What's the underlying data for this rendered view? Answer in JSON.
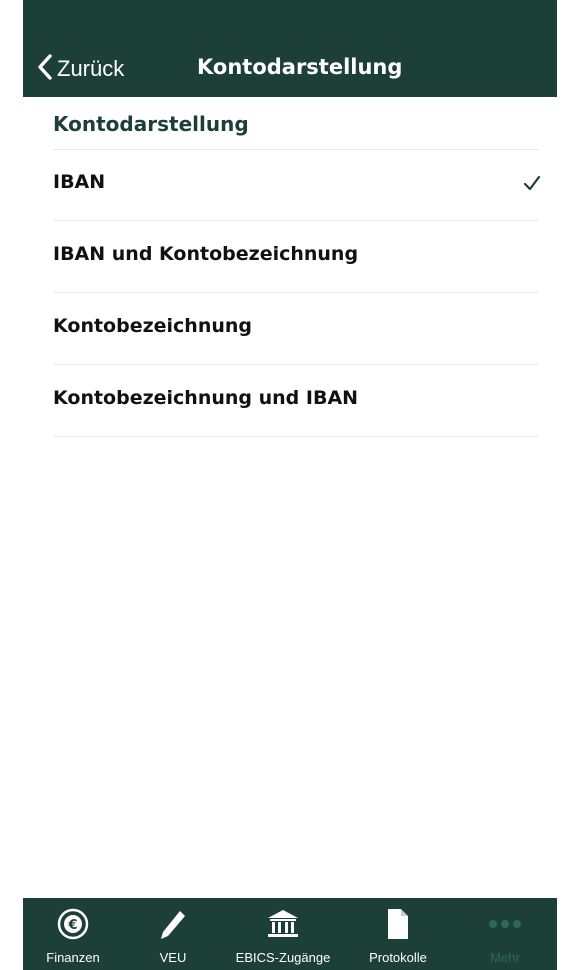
{
  "nav": {
    "back_label": "Zurück",
    "title": "Kontodarstellung"
  },
  "section": {
    "title": "Kontodarstellung"
  },
  "options": [
    {
      "label": "IBAN",
      "selected": true
    },
    {
      "label": "IBAN und Kontobezeichnung",
      "selected": false
    },
    {
      "label": "Kontobezeichnung",
      "selected": false
    },
    {
      "label": "Kontobezeichnung und IBAN",
      "selected": false
    }
  ],
  "tabs": [
    {
      "label": "Finanzen",
      "icon": "euro-icon"
    },
    {
      "label": "VEU",
      "icon": "pen-icon"
    },
    {
      "label": "EBICS-Zugänge",
      "icon": "bank-icon"
    },
    {
      "label": "Protokolle",
      "icon": "document-icon"
    },
    {
      "label": "Mehr",
      "icon": "more-icon"
    }
  ],
  "colors": {
    "brand": "#1c3f38",
    "inactive": "#2f6a57"
  }
}
